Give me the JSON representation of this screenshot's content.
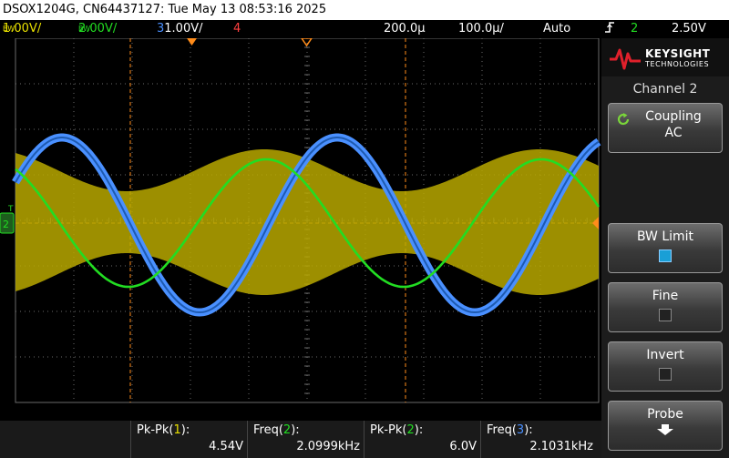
{
  "title": "DSOX1204G, CN64437127: Tue May 13 08:53:16 2025",
  "status": {
    "ch1_bw": "BW",
    "ch1_scale": "1.00V/",
    "ch2_bw": "BW",
    "ch2_scale": "2.00V/",
    "ch3_num": "3",
    "ch3_scale": "1.00V/",
    "ch4_num": "4",
    "delay": "200.0µ",
    "timebase": "100.0µ/",
    "trigger_mode": "Auto",
    "trigger_channel": "2",
    "trigger_level": "2.50V"
  },
  "brand": {
    "name": "KEYSIGHT",
    "sub": "TECHNOLOGIES"
  },
  "panel": {
    "title": "Channel 2",
    "coupling_label": "Coupling",
    "coupling_value": "AC",
    "bw_limit_label": "BW Limit",
    "bw_limit_checked": true,
    "fine_label": "Fine",
    "fine_checked": false,
    "invert_label": "Invert",
    "invert_checked": false,
    "probe_label": "Probe"
  },
  "markers": {
    "channel2_ground": "2"
  },
  "measurements": [
    {
      "name_pre": "Pk-Pk(",
      "ch": "1",
      "name_post": "):",
      "value": "4.54V"
    },
    {
      "name_pre": "Freq(",
      "ch": "2",
      "name_post": "):",
      "value": "2.0999kHz"
    },
    {
      "name_pre": "Pk-Pk(",
      "ch": "2",
      "name_post": "):",
      "value": "6.0V"
    },
    {
      "name_pre": "Freq(",
      "ch": "3",
      "name_post": "):",
      "value": "2.1031kHz"
    }
  ],
  "colors": {
    "ch1": "#e8e000",
    "ch2": "#22dd22",
    "ch3": "#4a90ff",
    "ch4": "#ff4040",
    "cursor": "#ff8c1a",
    "grid": "#6a6a6a"
  },
  "icons": {
    "coupling": "cycle-arrow-icon",
    "probe": "down-arrow-icon",
    "logo": "keysight-wave-icon"
  },
  "waveforms": {
    "ch1_envelope_fraction": [
      0.16,
      0.39
    ],
    "ch2_amplitude_divisions": 1.5,
    "ch3_amplitude_divisions": 2.5
  }
}
